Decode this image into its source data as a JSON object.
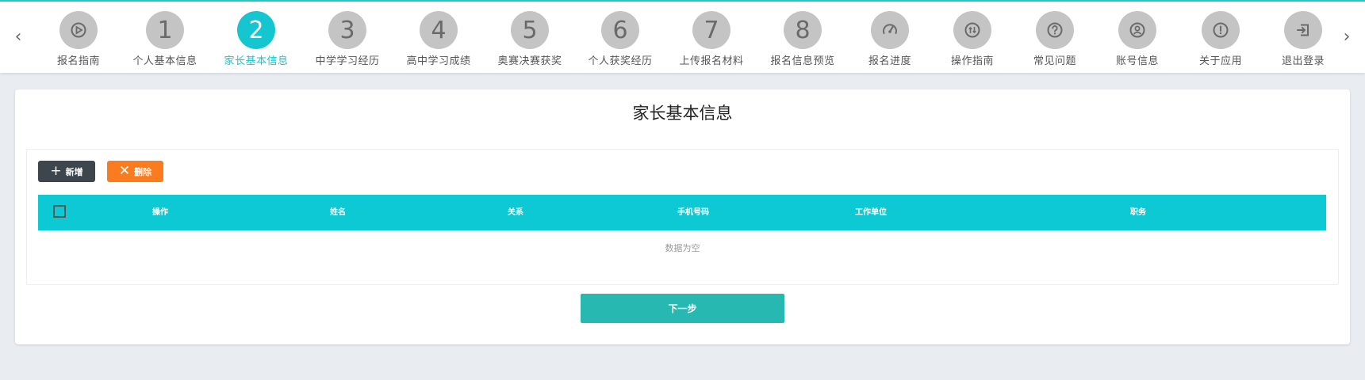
{
  "nav": {
    "prev_arrow": "‹",
    "next_arrow": "›",
    "steps": [
      {
        "type": "icon",
        "icon": "play-icon",
        "label": "报名指南"
      },
      {
        "type": "number",
        "number": "1",
        "label": "个人基本信息"
      },
      {
        "type": "number",
        "number": "2",
        "label": "家长基本信息",
        "active": true
      },
      {
        "type": "number",
        "number": "3",
        "label": "中学学习经历"
      },
      {
        "type": "number",
        "number": "4",
        "label": "高中学习成绩"
      },
      {
        "type": "number",
        "number": "5",
        "label": "奥赛决赛获奖"
      },
      {
        "type": "number",
        "number": "6",
        "label": "个人获奖经历"
      },
      {
        "type": "number",
        "number": "7",
        "label": "上传报名材料"
      },
      {
        "type": "number",
        "number": "8",
        "label": "报名信息预览"
      },
      {
        "type": "icon",
        "icon": "speedometer-icon",
        "label": "报名进度"
      },
      {
        "type": "icon",
        "icon": "guide-icon",
        "label": "操作指南"
      },
      {
        "type": "icon",
        "icon": "question-icon",
        "label": "常见问题"
      },
      {
        "type": "icon",
        "icon": "account-icon",
        "label": "账号信息"
      },
      {
        "type": "icon",
        "icon": "info-icon",
        "label": "关于应用"
      },
      {
        "type": "icon",
        "icon": "logout-icon",
        "label": "退出登录"
      }
    ]
  },
  "main": {
    "title": "家长基本信息",
    "toolbar": {
      "add_icon": "+",
      "add_label": "新增",
      "delete_icon": "✕",
      "delete_label": "删除"
    },
    "table": {
      "columns": [
        "操作",
        "姓名",
        "关系",
        "手机号码",
        "工作单位",
        "职务"
      ],
      "rows": [],
      "empty_text": "数据为空"
    },
    "next_label": "下一步"
  },
  "colors": {
    "accent": "#15c5cf",
    "table_header": "#0dc9d3",
    "add_button": "#3d464d",
    "delete_button": "#fa7c1e",
    "next_button": "#26b8b1"
  }
}
